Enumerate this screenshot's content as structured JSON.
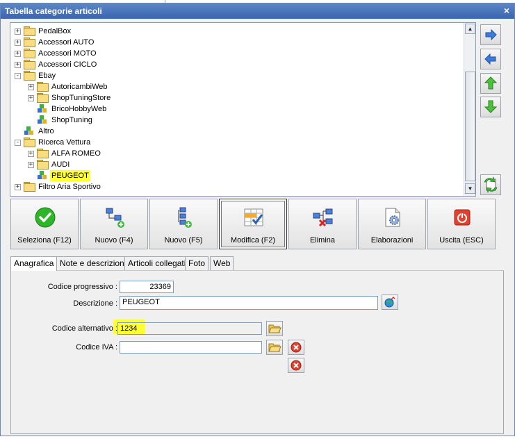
{
  "window": {
    "title": "Tabella categorie articoli"
  },
  "tree": {
    "items": [
      {
        "label": "PedalBox",
        "level": 0,
        "expander": "+",
        "icon": "folder-icon"
      },
      {
        "label": "Accessori AUTO",
        "level": 0,
        "expander": "+",
        "icon": "folder-icon"
      },
      {
        "label": "Accessori MOTO",
        "level": 0,
        "expander": "+",
        "icon": "folder-icon"
      },
      {
        "label": "Accessori CICLO",
        "level": 0,
        "expander": "+",
        "icon": "folder-icon"
      },
      {
        "label": "Ebay",
        "level": 0,
        "expander": "-",
        "icon": "folder-icon"
      },
      {
        "label": "AutoricambiWeb",
        "level": 1,
        "expander": "+",
        "icon": "folder-icon"
      },
      {
        "label": "ShopTuningStore",
        "level": 1,
        "expander": "+",
        "icon": "folder-icon"
      },
      {
        "label": "BricoHobbyWeb",
        "level": 1,
        "expander": "",
        "icon": "blocks-icon"
      },
      {
        "label": "ShopTuning",
        "level": 1,
        "expander": "",
        "icon": "blocks-icon"
      },
      {
        "label": "Altro",
        "level": 0,
        "expander": "",
        "icon": "blocks-icon"
      },
      {
        "label": "Ricerca Vettura",
        "level": 0,
        "expander": "-",
        "icon": "folder-icon"
      },
      {
        "label": "ALFA ROMEO",
        "level": 1,
        "expander": "+",
        "icon": "folder-icon"
      },
      {
        "label": "AUDI",
        "level": 1,
        "expander": "+",
        "icon": "folder-icon"
      },
      {
        "label": "PEUGEOT",
        "level": 1,
        "expander": "",
        "icon": "blocks-icon",
        "selected": true
      },
      {
        "label": "Filtro Aria Sportivo",
        "level": 0,
        "expander": "+",
        "icon": "folder-icon"
      }
    ]
  },
  "toolbar": {
    "buttons": [
      {
        "label": "Seleziona (F12)",
        "icon": "checkmark-icon"
      },
      {
        "label": "Nuovo (F4)",
        "icon": "new-sibling-icon"
      },
      {
        "label": "Nuovo (F5)",
        "icon": "new-child-icon"
      },
      {
        "label": "Modifica (F2)",
        "icon": "edit-table-icon",
        "active": true
      },
      {
        "label": "Elimina",
        "icon": "delete-node-icon"
      },
      {
        "label": "Elaborazioni",
        "icon": "process-gear-icon"
      },
      {
        "label": "Uscita (ESC)",
        "icon": "power-off-icon"
      }
    ]
  },
  "tabs": [
    "Anagrafica",
    "Note e descrizioni",
    "Articoli collegati",
    "Foto",
    "Web"
  ],
  "form": {
    "progressivo_label": "Codice progressivo :",
    "progressivo_value": "23369",
    "descrizione_label": "Descrizione :",
    "descrizione_value": "PEUGEOT",
    "alternativo_label": "Codice alternativo :",
    "alternativo_value": "1234",
    "iva_label": "Codice IVA :",
    "iva_value": ""
  },
  "colors": {
    "title_bar": "#3a65ae",
    "highlight": "#ffff33"
  }
}
